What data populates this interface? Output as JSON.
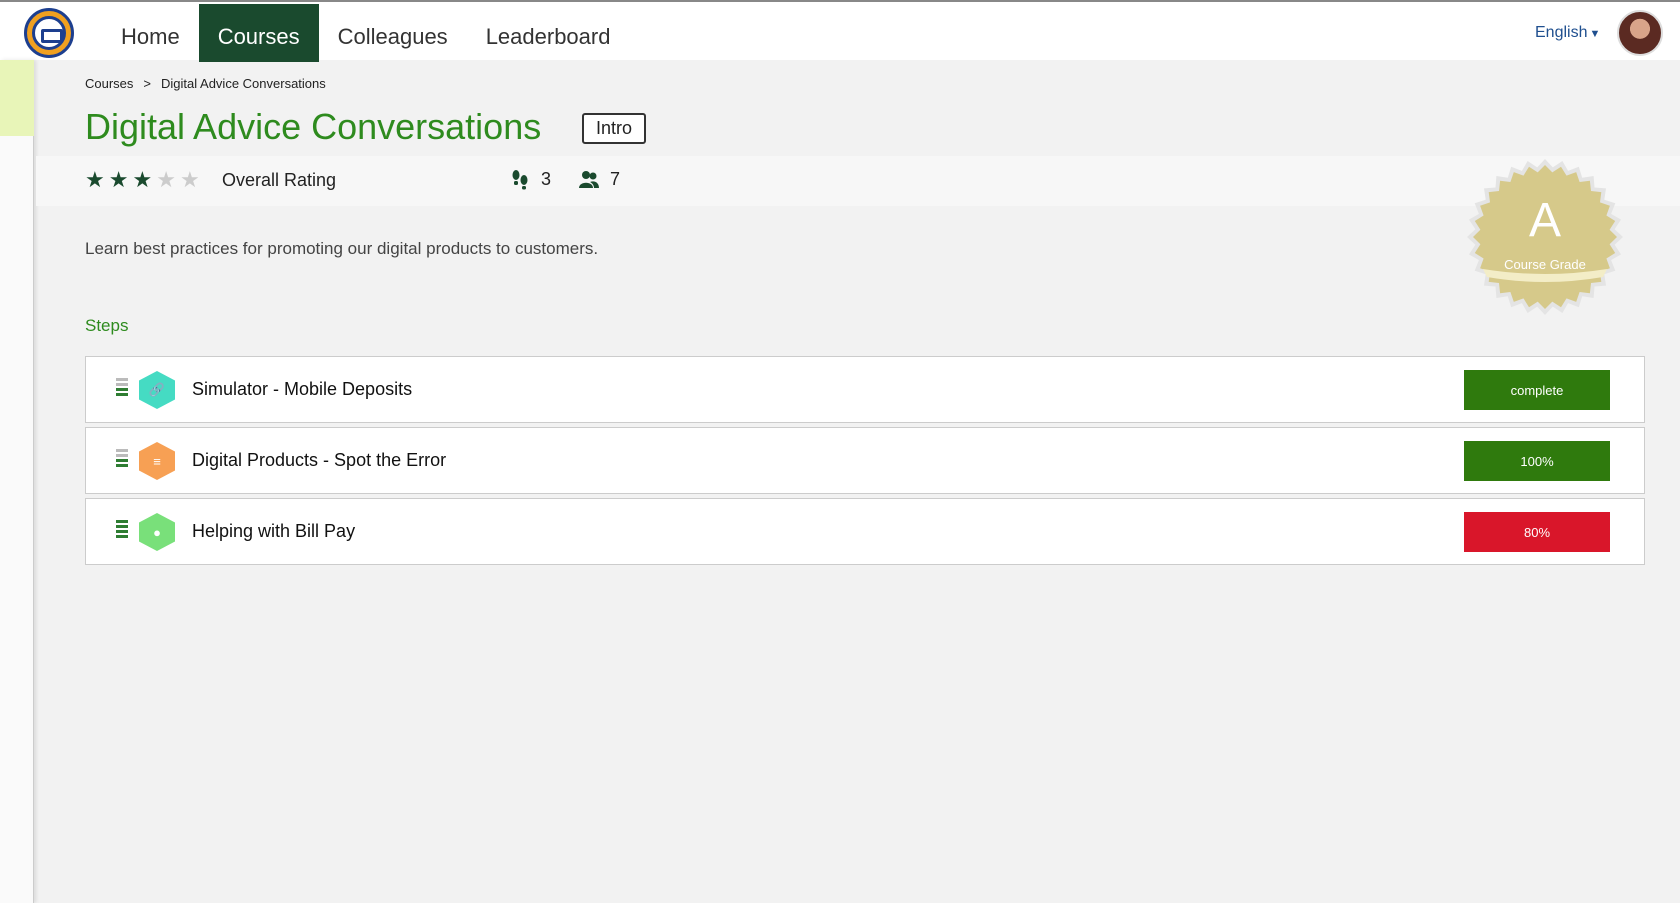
{
  "nav": {
    "items": [
      {
        "label": "Home",
        "active": false
      },
      {
        "label": "Courses",
        "active": true
      },
      {
        "label": "Colleagues",
        "active": false
      },
      {
        "label": "Leaderboard",
        "active": false
      }
    ]
  },
  "language": "English",
  "breadcrumb": {
    "root": "Courses",
    "separator": ">",
    "current": "Digital Advice Conversations"
  },
  "course": {
    "title": "Digital Advice Conversations",
    "level": "Intro",
    "rating_stars": 3,
    "rating_max": 5,
    "rating_label": "Overall Rating",
    "steps_count": "3",
    "participants_count": "7",
    "description": "Learn best practices for promoting our digital products to customers.",
    "grade_letter": "A",
    "grade_label": "Course Grade"
  },
  "steps_heading": "Steps",
  "steps": [
    {
      "title": "Simulator - Mobile Deposits",
      "icon": "link-icon",
      "status": "complete",
      "status_color": "#2f7a0d"
    },
    {
      "title": "Digital Products - Spot the Error",
      "icon": "document-icon",
      "status": "100%",
      "status_color": "#2f7a0d"
    },
    {
      "title": "Helping with Bill Pay",
      "icon": "role-play-icon",
      "status": "80%",
      "status_color": "#d9162a"
    }
  ],
  "colors": {
    "brand_green": "#2e8b1e",
    "nav_active": "#1a4a2e",
    "grade_gold": "#d6c98a"
  }
}
